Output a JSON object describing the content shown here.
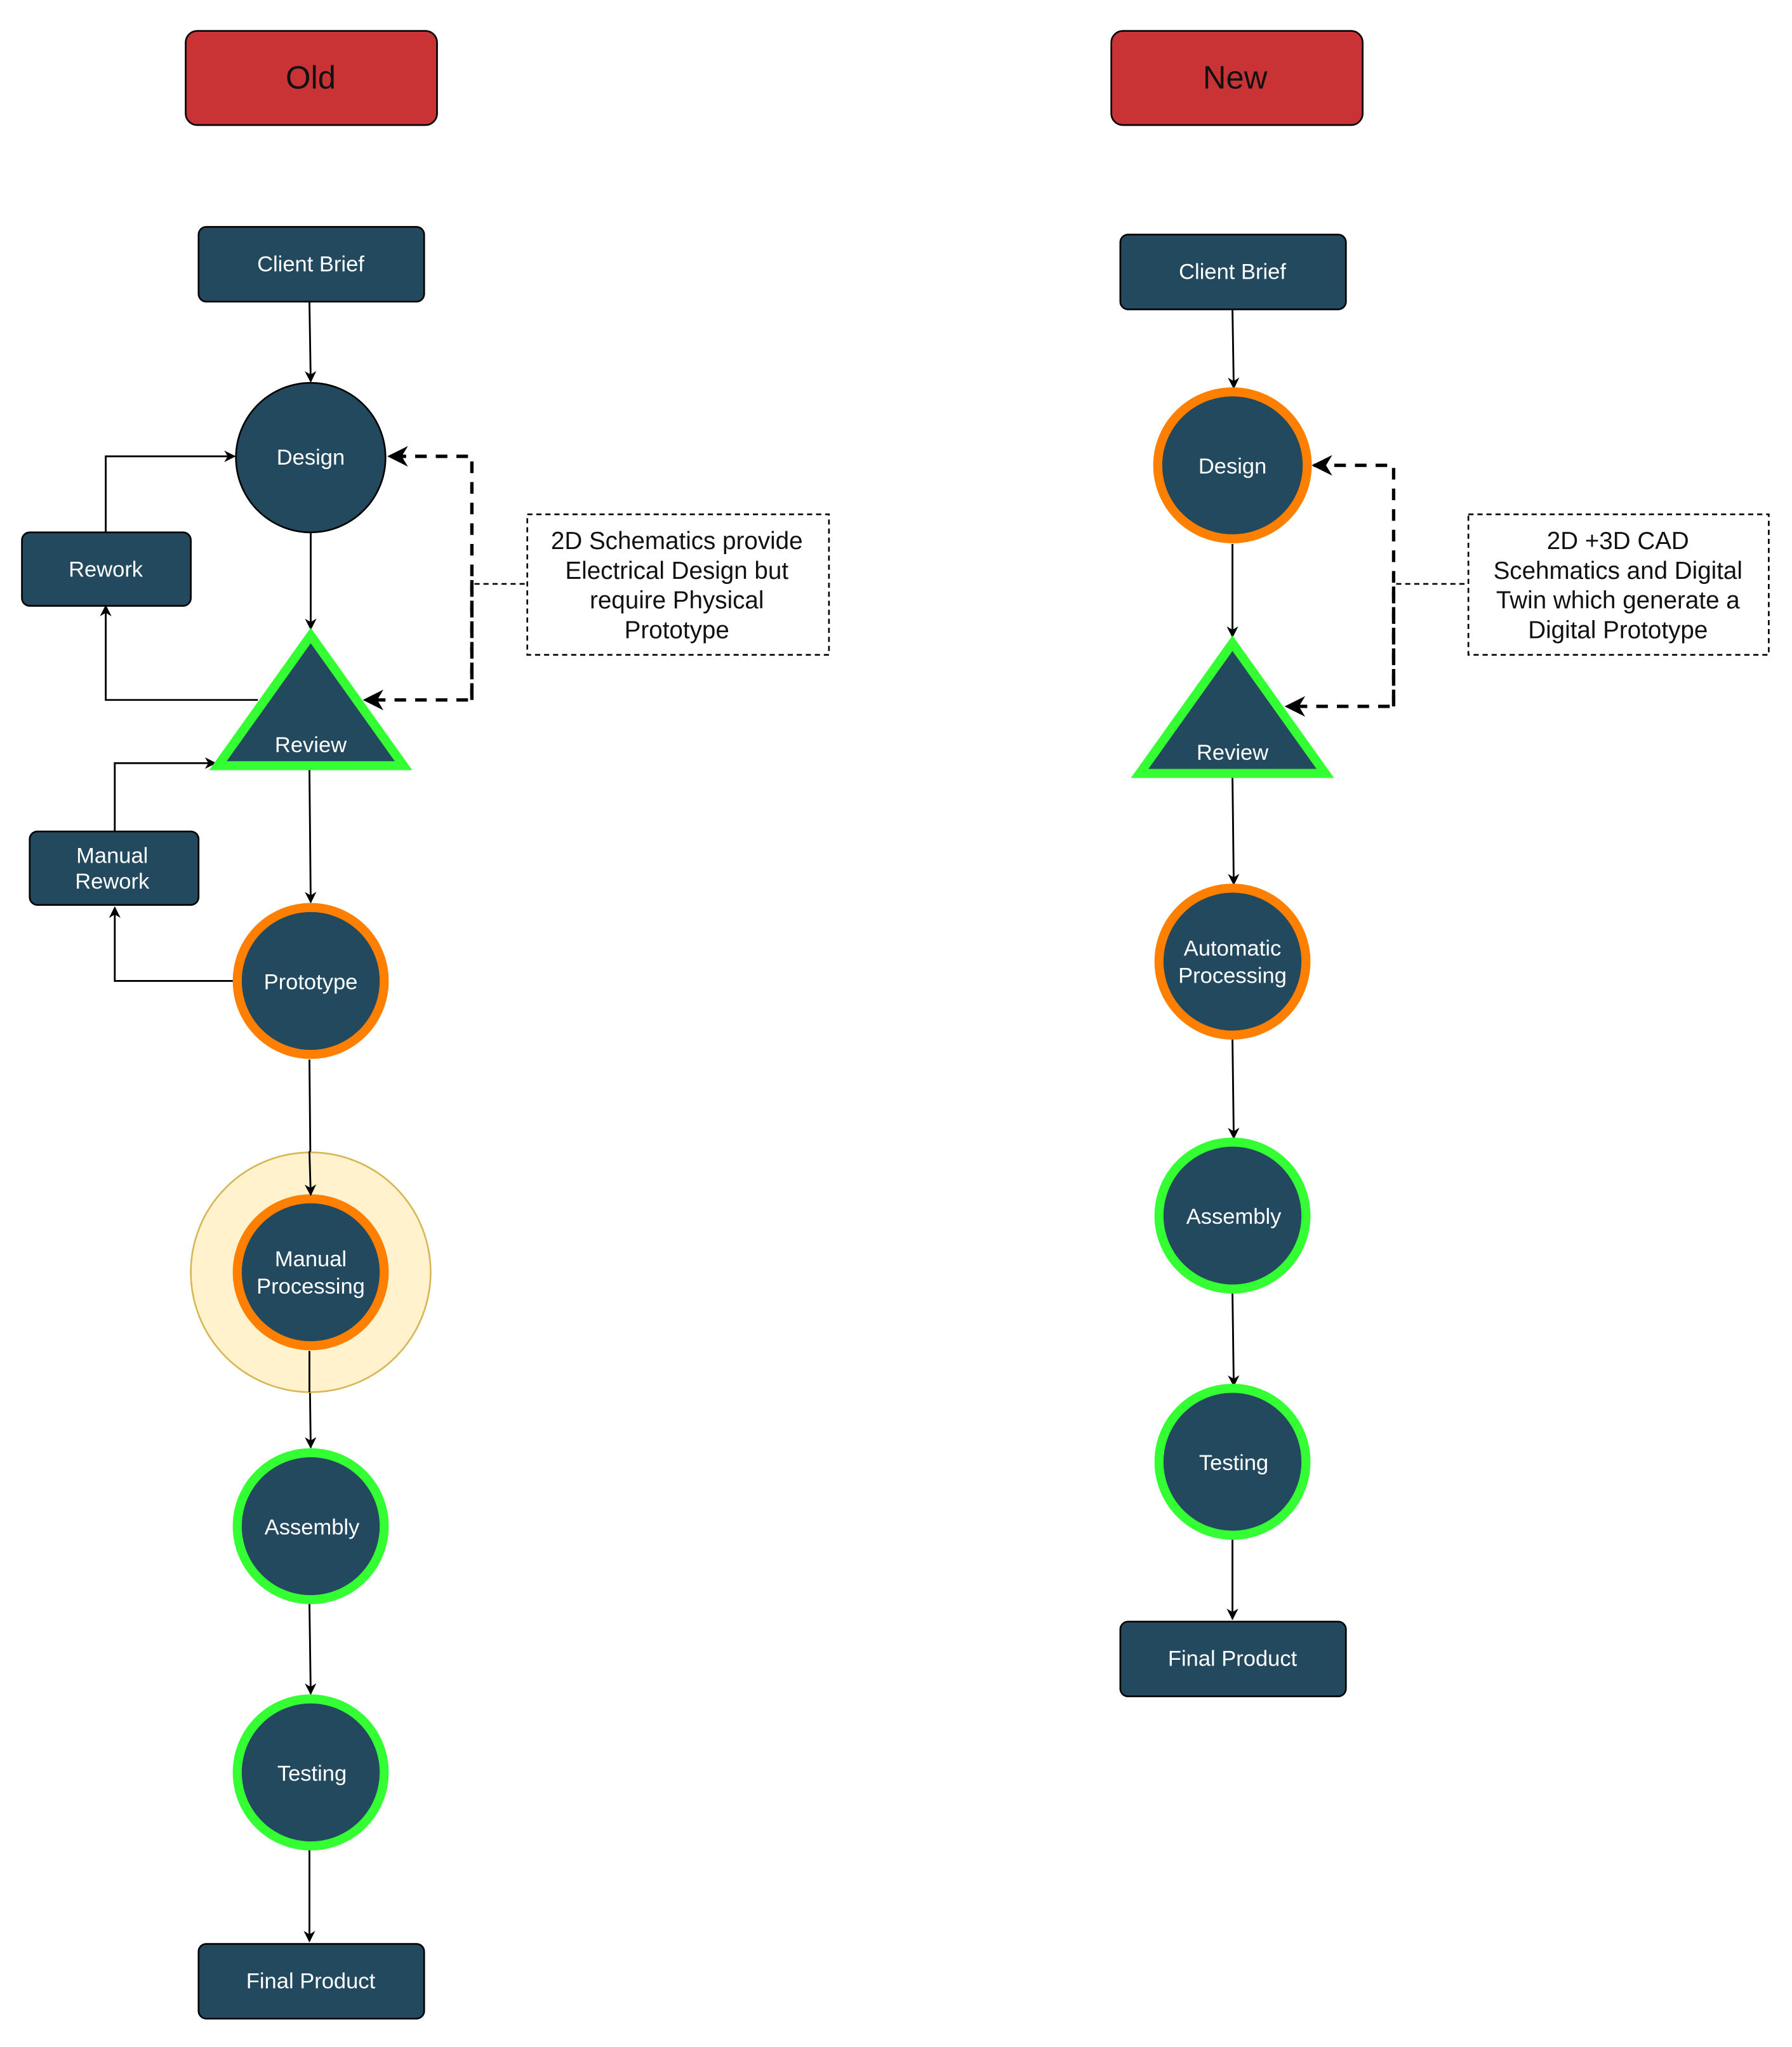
{
  "colors": {
    "header_fill": "#c93336",
    "node_fill": "#23495f",
    "orange_ring": "#ff8000",
    "green_ring": "#33ff33",
    "highlight_halo": "#fff2cc",
    "highlight_halo_stroke": "#d6b656"
  },
  "old": {
    "header": "Old",
    "nodes": {
      "client_brief": "Client Brief",
      "design": "Design",
      "rework": "Rework",
      "review": "Review",
      "manual_rework": [
        "Manual",
        "Rework"
      ],
      "prototype": "Prototype",
      "manual_processing": [
        "Manual",
        "Processing"
      ],
      "assembly": "Assembly",
      "testing": "Testing",
      "final_product": "Final Product"
    },
    "note": [
      "2D Schematics provide",
      "Electrical Design but",
      "require Physical",
      "Prototype"
    ]
  },
  "new": {
    "header": "New",
    "nodes": {
      "client_brief": "Client Brief",
      "design": "Design",
      "review": "Review",
      "automatic_processing": [
        "Automatic",
        "Processing"
      ],
      "assembly": "Assembly",
      "testing": "Testing",
      "final_product": "Final Product"
    },
    "note": [
      "2D +3D CAD",
      "Scehmatics and Digital",
      "Twin which generate a",
      "Digital Prototype"
    ]
  }
}
